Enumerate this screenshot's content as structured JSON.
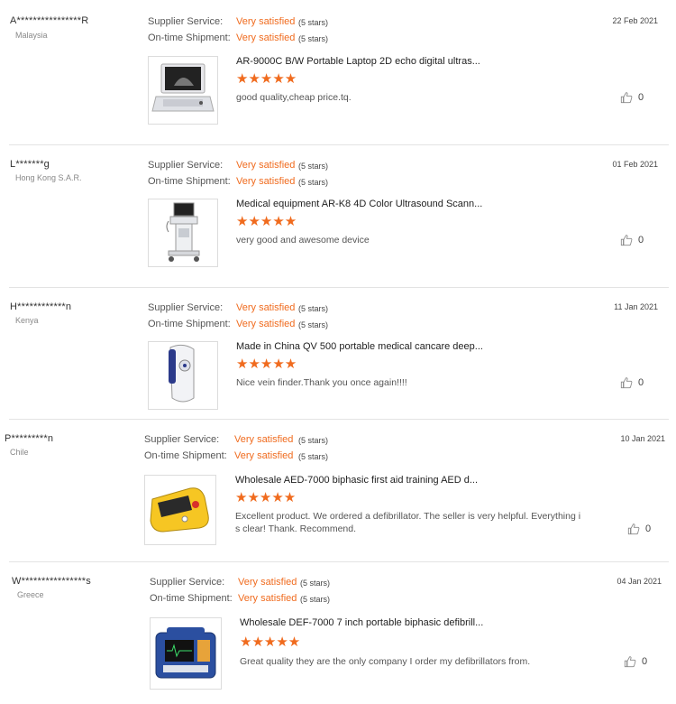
{
  "labels": {
    "supplier_service": "Supplier Service:",
    "ontime_shipment": "On-time Shipment:"
  },
  "reviews": [
    {
      "buyer": "A****************R",
      "country": "Malaysia",
      "supplier_rating": "Very satisfied",
      "supplier_stars": "(5 stars)",
      "shipment_rating": "Very satisfied",
      "shipment_stars": "(5 stars)",
      "date": "22 Feb 2021",
      "product": "AR-9000C B/W Portable Laptop 2D echo digital ultras...",
      "stars": "★★★★★",
      "comment": "good quality,cheap price.tq.",
      "likes": "0"
    },
    {
      "buyer": "L*******g",
      "country": "Hong Kong S.A.R.",
      "supplier_rating": "Very satisfied",
      "supplier_stars": "(5 stars)",
      "shipment_rating": "Very satisfied",
      "shipment_stars": "(5 stars)",
      "date": "01 Feb 2021",
      "product": "Medical equipment AR-K8 4D Color Ultrasound Scann...",
      "stars": "★★★★★",
      "comment": "very good and awesome device",
      "likes": "0"
    },
    {
      "buyer": "H************n",
      "country": "Kenya",
      "supplier_rating": "Very satisfied",
      "supplier_stars": "(5 stars)",
      "shipment_rating": "Very satisfied",
      "shipment_stars": "(5 stars)",
      "date": "11 Jan 2021",
      "product": "Made in China QV 500 portable medical cancare deep...",
      "stars": "★★★★★",
      "comment": "Nice vein finder.Thank you once again!!!!",
      "likes": "0"
    },
    {
      "buyer": "P*********n",
      "country": "Chile",
      "supplier_rating": "Very satisfied",
      "supplier_stars": "(5 stars)",
      "shipment_rating": "Very satisfied",
      "shipment_stars": "(5 stars)",
      "date": "10 Jan 2021",
      "product": "Wholesale AED-7000 biphasic first aid training AED d...",
      "stars": "★★★★★",
      "comment_line1": "Excellent product. We ordered a defibrillator. The seller is very helpful. Everything i",
      "comment_line2": "s clear! Thank. Recommend.",
      "likes": "0"
    },
    {
      "buyer": "W****************s",
      "country": "Greece",
      "supplier_rating": "Very satisfied",
      "supplier_stars": "(5 stars)",
      "shipment_rating": "Very satisfied",
      "shipment_stars": "(5 stars)",
      "date": "04 Jan 2021",
      "product": "Wholesale DEF-7000 7 inch portable biphasic defibrill...",
      "stars": "★★★★★",
      "comment": "Great quality they are the only company I order my defibrillators from.",
      "likes": "0"
    }
  ],
  "colors": {
    "accent": "#f06b1e",
    "divider": "#e3e3e3"
  }
}
